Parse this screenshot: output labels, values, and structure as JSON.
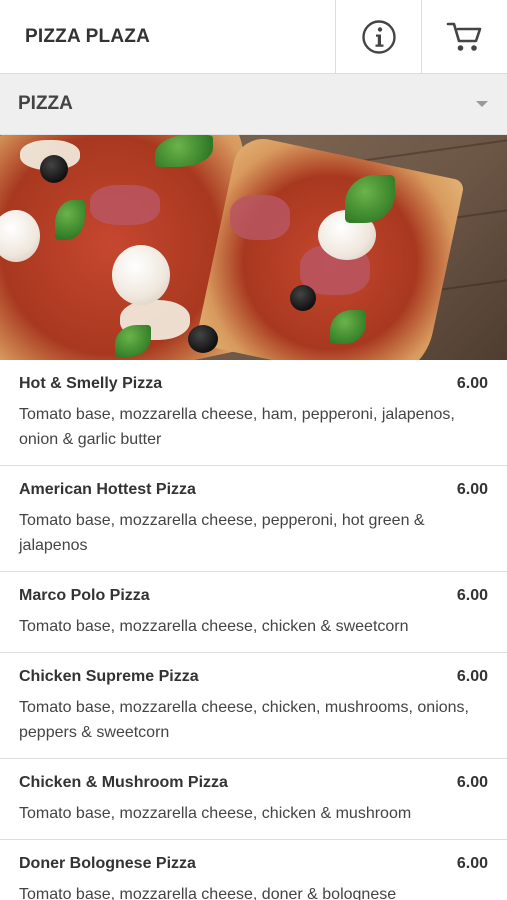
{
  "header": {
    "title": "PIZZA PLAZA",
    "info_icon": "info-icon",
    "cart_icon": "cart-icon"
  },
  "category": {
    "label": "PIZZA",
    "icon": "caret-down-icon"
  },
  "hero": {
    "alt": "pizza-slices-photo"
  },
  "colors": {
    "text": "#333333",
    "divider": "#dedede",
    "category_bg": "#efefef"
  },
  "menu": {
    "items": [
      {
        "name": "Hot & Smelly Pizza",
        "price": "6.00",
        "description": "Tomato base, mozzarella cheese, ham, pepperoni, jalapenos, onion & garlic butter"
      },
      {
        "name": "American Hottest Pizza",
        "price": "6.00",
        "description": "Tomato base, mozzarella cheese, pepperoni, hot green & jalapenos"
      },
      {
        "name": "Marco Polo Pizza",
        "price": "6.00",
        "description": "Tomato base, mozzarella cheese, chicken & sweetcorn"
      },
      {
        "name": "Chicken Supreme Pizza",
        "price": "6.00",
        "description": "Tomato base, mozzarella cheese, chicken, mushrooms, onions, peppers & sweetcorn"
      },
      {
        "name": "Chicken & Mushroom Pizza",
        "price": "6.00",
        "description": "Tomato base, mozzarella cheese, chicken & mushroom"
      },
      {
        "name": "Doner Bolognese Pizza",
        "price": "6.00",
        "description": "Tomato base, mozzarella cheese, doner & bolognese"
      }
    ]
  }
}
